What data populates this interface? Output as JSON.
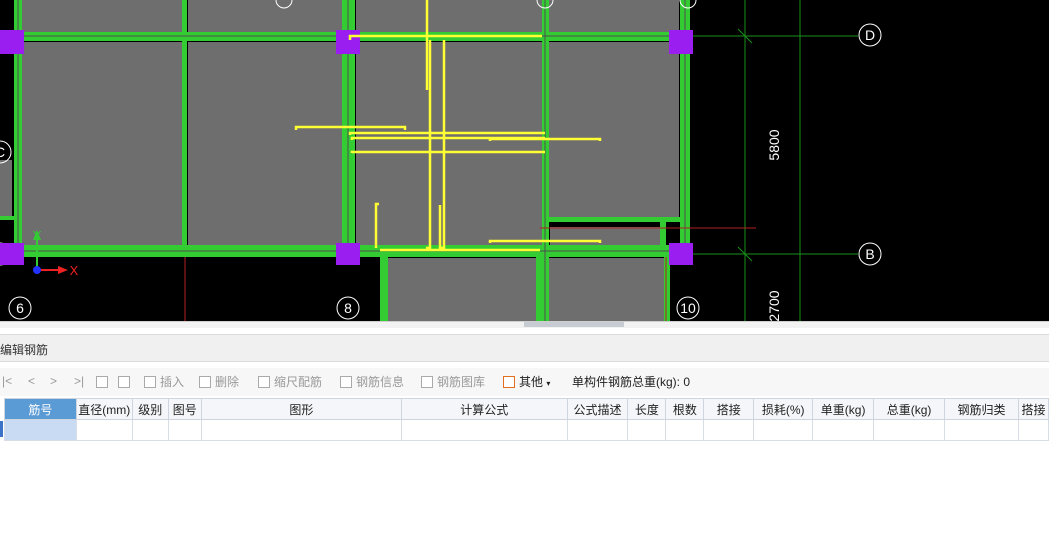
{
  "axes": {
    "rows": [
      "D",
      "B",
      "C",
      "B"
    ],
    "cols": [
      "6",
      "8",
      "10"
    ],
    "dims": [
      "5800",
      "2700"
    ],
    "ucs": {
      "x": "X",
      "y": "Y"
    }
  },
  "panel": {
    "title": "编辑钢筋"
  },
  "toolbar": {
    "nav": [
      "|<",
      "<",
      ">",
      ">|"
    ],
    "insert": "插入",
    "delete": "删除",
    "scale": "缩尺配筋",
    "info": "钢筋信息",
    "library": "钢筋图库",
    "other": "其他",
    "total_label": "单构件钢筋总重(kg):",
    "total_value": "0"
  },
  "table": {
    "headers": [
      "筋号",
      "直径(mm)",
      "级别",
      "图号",
      "图形",
      "计算公式",
      "公式描述",
      "长度",
      "根数",
      "搭接",
      "损耗(%)",
      "单重(kg)",
      "总重(kg)",
      "钢筋归类",
      "搭接"
    ]
  },
  "colors": {
    "beam": "#33cc33",
    "slab": "#6e6e6e",
    "column": "#9a1ef0",
    "rebar": "#ffff33",
    "grid": "#1a8f1a"
  }
}
